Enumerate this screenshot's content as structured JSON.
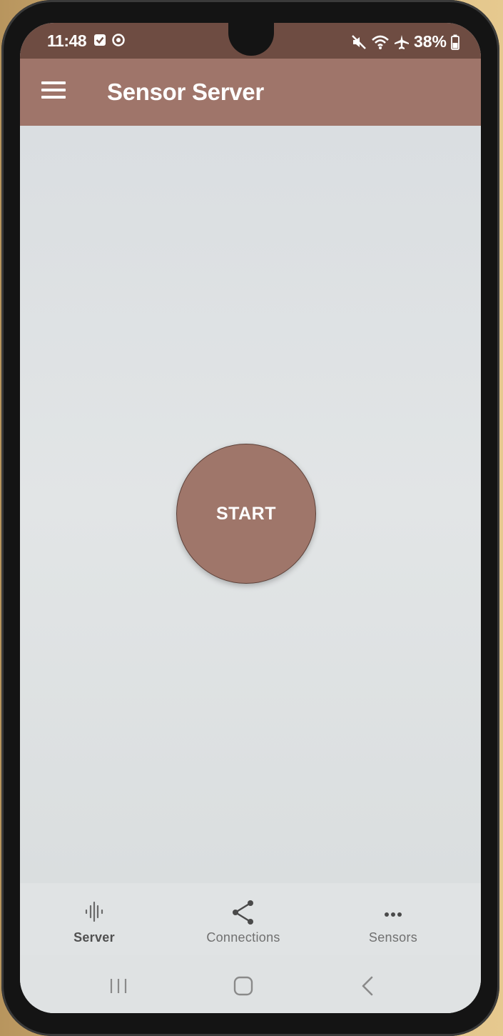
{
  "status_bar": {
    "time": "11:48",
    "battery_percent": "38%",
    "icons": [
      "checkbox-notification-icon",
      "smiley-notification-icon",
      "mute-icon",
      "wifi-icon",
      "airplane-mode-icon",
      "battery-icon"
    ]
  },
  "app_bar": {
    "title": "Sensor Server",
    "menu_icon": "hamburger-menu-icon"
  },
  "main": {
    "start_label": "START"
  },
  "bottom_nav": {
    "items": [
      {
        "label": "Server",
        "icon": "waveform-icon",
        "active": true
      },
      {
        "label": "Connections",
        "icon": "share-nodes-icon",
        "active": false
      },
      {
        "label": "Sensors",
        "icon": "more-dots-icon",
        "active": false
      }
    ]
  },
  "system_nav": {
    "buttons": [
      "recents-icon",
      "home-icon",
      "back-icon"
    ]
  },
  "colors": {
    "app_bar": "#9f756a",
    "status_bar": "#6e4c42",
    "start_button": "#9f766a",
    "background": "#dcdfe0"
  }
}
